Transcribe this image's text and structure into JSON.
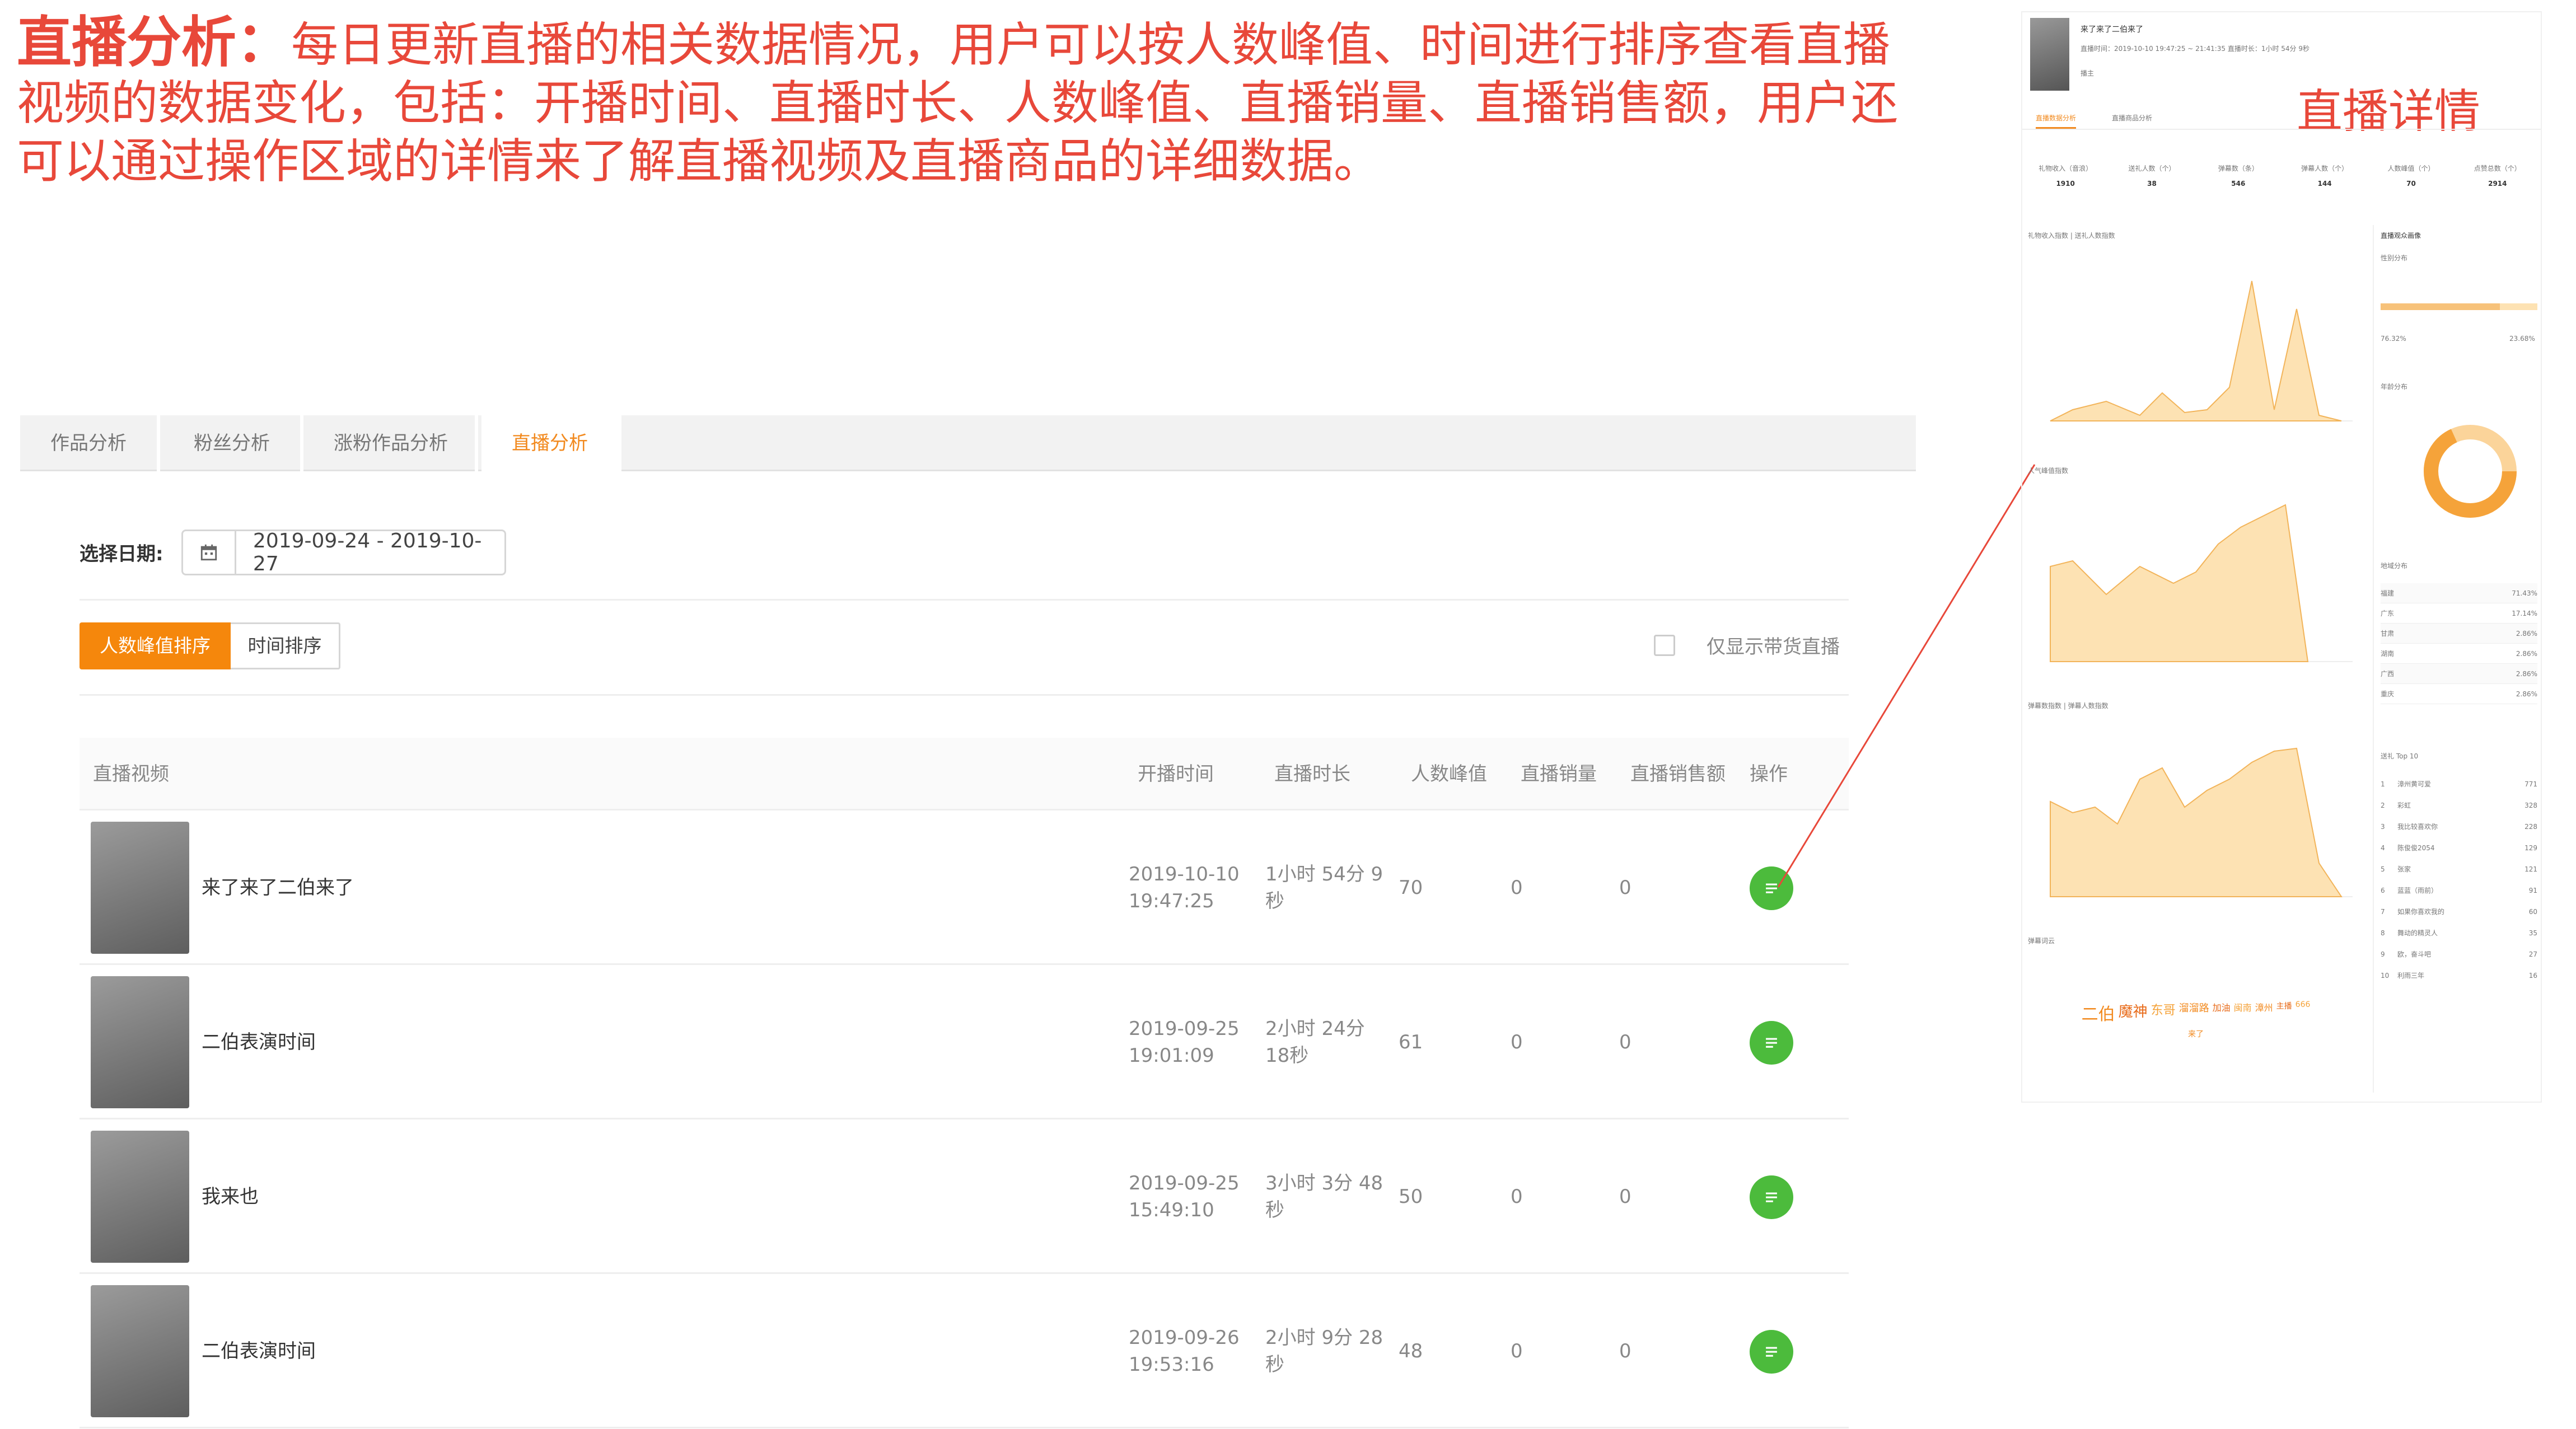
{
  "intro": {
    "lead": "直播分析：",
    "text": "每日更新直播的相关数据情况，用户可以按人数峰值、时间进行排序查看直播视频的数据变化，包括：开播时间、直播时长、人数峰值、直播销量、直播销售额，用户还可以通过操作区域的详情来了解直播视频及直播商品的详细数据。"
  },
  "tabs": [
    "作品分析",
    "粉丝分析",
    "涨粉作品分析",
    "直播分析"
  ],
  "filter": {
    "date_label": "选择日期:",
    "date_range": "2019-09-24 - 2019-10-27"
  },
  "sort": {
    "peak": "人数峰值排序",
    "time": "时间排序",
    "only_goods": "仅显示带货直播"
  },
  "table": {
    "headers": [
      "直播视频",
      "开播时间",
      "直播时长",
      "人数峰值",
      "直播销量",
      "直播销售额",
      "操作"
    ],
    "rows": [
      {
        "title": "来了来了二伯来了",
        "start_date": "2019-10-10",
        "start_time": "19:47:25",
        "dur1": "1小时 54分 9",
        "dur2": "秒",
        "peak": "70",
        "sales": "0",
        "revenue": "0"
      },
      {
        "title": "二伯表演时间",
        "start_date": "2019-09-25",
        "start_time": "19:01:09",
        "dur1": "2小时 24分",
        "dur2": "18秒",
        "peak": "61",
        "sales": "0",
        "revenue": "0"
      },
      {
        "title": "我来也",
        "start_date": "2019-09-25",
        "start_time": "15:49:10",
        "dur1": "3小时 3分 48",
        "dur2": "秒",
        "peak": "50",
        "sales": "0",
        "revenue": "0"
      },
      {
        "title": "二伯表演时间",
        "start_date": "2019-09-26",
        "start_time": "19:53:16",
        "dur1": "2小时 9分 28",
        "dur2": "秒",
        "peak": "48",
        "sales": "0",
        "revenue": "0"
      }
    ]
  },
  "detail": {
    "label": "直播详情",
    "title": "来了来了二伯来了",
    "meta": "直播时间：2019-10-10 19:47:25 ~ 21:41:35  直播时长：1小时 54分 9秒",
    "host_label": "播主",
    "tabs": [
      "直播数据分析",
      "直播商品分析"
    ],
    "stats": [
      {
        "label": "礼物收入（音浪）",
        "value": "1910"
      },
      {
        "label": "送礼人数（个）",
        "value": "38"
      },
      {
        "label": "弹幕数（条）",
        "value": "546"
      },
      {
        "label": "弹幕人数（个）",
        "value": "144"
      },
      {
        "label": "人数峰值（个）",
        "value": "70"
      },
      {
        "label": "点赞总数（个）",
        "value": "2914"
      }
    ],
    "chart_titles": [
      "礼物收入指数 | 送礼人数指数",
      "人气峰值指数",
      "弹幕数指数 | 弹幕人数指数",
      "弹幕词云"
    ],
    "right_titles": [
      "直播观众画像",
      "性别分布",
      "年龄分布",
      "地域分布",
      "送礼 Top 10"
    ],
    "gender": {
      "male": "76.32%",
      "female": "23.68%"
    },
    "regions": [
      {
        "name": "福建",
        "pct": "71.43%"
      },
      {
        "name": "广东",
        "pct": "17.14%"
      },
      {
        "name": "甘肃",
        "pct": "2.86%"
      },
      {
        "name": "湖南",
        "pct": "2.86%"
      },
      {
        "name": "广西",
        "pct": "2.86%"
      },
      {
        "name": "重庆",
        "pct": "2.86%"
      }
    ],
    "top_gifts": [
      {
        "rank": "1",
        "name": "漳州黄可爱",
        "val": "771"
      },
      {
        "rank": "2",
        "name": "彩虹",
        "val": "328"
      },
      {
        "rank": "3",
        "name": "我比较喜欢你",
        "val": "228"
      },
      {
        "rank": "4",
        "name": "陈俊俊2054",
        "val": "129"
      },
      {
        "rank": "5",
        "name": "张家",
        "val": "121"
      },
      {
        "rank": "6",
        "name": "蓝蓝（雨前）",
        "val": "91"
      },
      {
        "rank": "7",
        "name": "如果你喜欢我的",
        "val": "60"
      },
      {
        "rank": "8",
        "name": "舞动的精灵人",
        "val": "35"
      },
      {
        "rank": "9",
        "name": "欧，奋斗吧",
        "val": "27"
      },
      {
        "rank": "10",
        "name": "利雨三年",
        "val": "16"
      }
    ],
    "word_cloud": [
      "二伯",
      "魔神",
      "东哥",
      "溜溜路",
      "加油",
      "闽南",
      "漳州",
      "主播",
      "666",
      "来了"
    ]
  },
  "colors": {
    "accent": "#f5870c",
    "intro": "#e8483a",
    "op": "#4cbb3c",
    "chart_fill": "#fde2b3",
    "chart_line": "#f2b45a"
  }
}
